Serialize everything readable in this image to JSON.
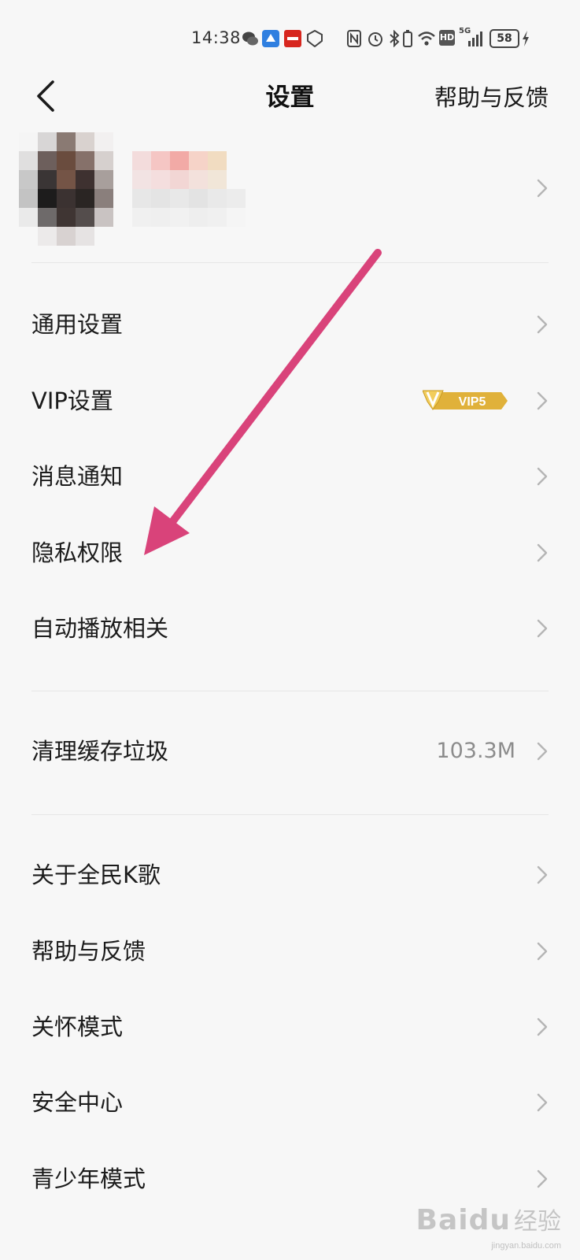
{
  "status_bar": {
    "time": "14:38",
    "battery": "58",
    "network": "5G",
    "hd": "HD",
    "icons": [
      "wechat-icon",
      "app-icon",
      "red-app-icon",
      "shield-icon",
      "nfc-icon",
      "alarm-icon",
      "bluetooth-icon",
      "battery-small-icon",
      "wifi-icon",
      "hd-icon",
      "signal-icon",
      "battery-icon",
      "charging-icon"
    ]
  },
  "nav": {
    "title": "设置",
    "help": "帮助与反馈"
  },
  "settings": {
    "general": "通用设置",
    "vip": "VIP设置",
    "vip_badge": "VIP5",
    "notifications": "消息通知",
    "privacy": "隐私权限",
    "autoplay": "自动播放相关",
    "cache": "清理缓存垃圾",
    "cache_size": "103.3M",
    "about": "关于全民K歌",
    "help": "帮助与反馈",
    "care_mode": "关怀模式",
    "security": "安全中心",
    "youth_mode": "青少年模式"
  },
  "watermark": {
    "brand": "Baidu",
    "sub": "经验",
    "url": "jingyan.baidu.com"
  },
  "colors": {
    "annotation_arrow": "#d9437a",
    "vip_gold": "#e0b13a",
    "background": "#f7f7f7"
  }
}
